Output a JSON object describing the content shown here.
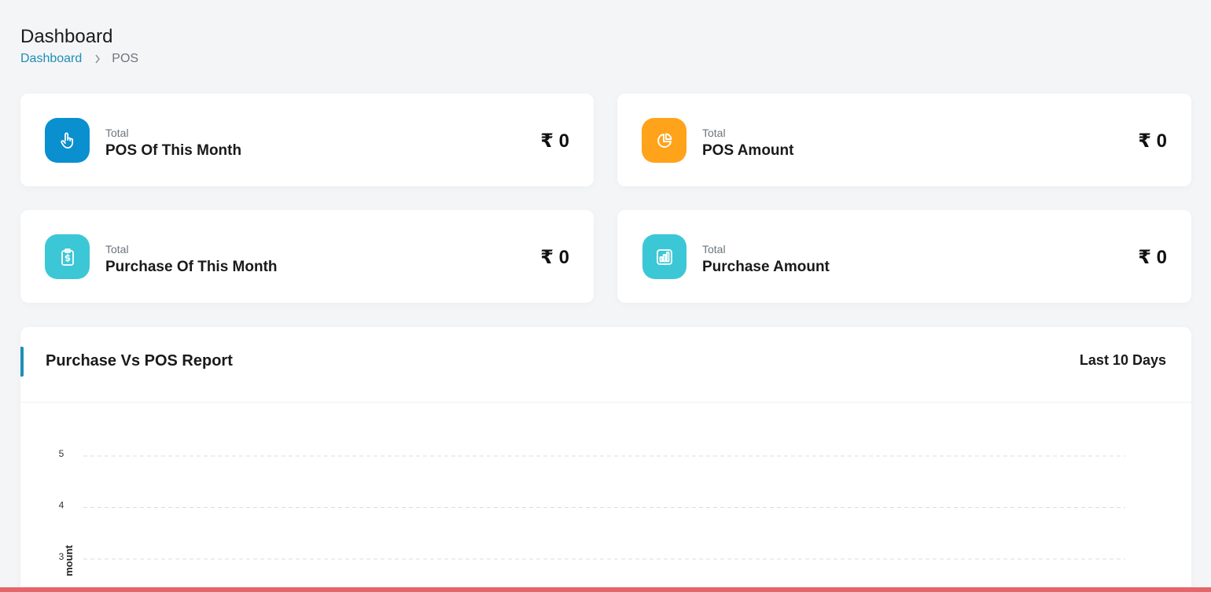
{
  "page": {
    "title": "Dashboard",
    "breadcrumb": {
      "home": "Dashboard",
      "current": "POS"
    }
  },
  "stats": [
    {
      "small": "Total",
      "label": "POS Of This Month",
      "value": "₹ 0",
      "icon": "pointer-hand-icon",
      "color": "#0a8fcf"
    },
    {
      "small": "Total",
      "label": "POS Amount",
      "value": "₹ 0",
      "icon": "pie-chart-icon",
      "color": "#ffa31a"
    },
    {
      "small": "Total",
      "label": "Purchase Of This Month",
      "value": "₹ 0",
      "icon": "clipboard-dollar-icon",
      "color": "#3cc7d6"
    },
    {
      "small": "Total",
      "label": "Purchase Amount",
      "value": "₹ 0",
      "icon": "bar-chart-icon",
      "color": "#3cc7d6"
    }
  ],
  "report": {
    "title": "Purchase Vs POS Report",
    "filter": "Last 10 Days"
  },
  "chart_data": {
    "type": "line",
    "ylabel": "mount",
    "y_ticks": [
      "5",
      "4",
      "3"
    ],
    "ylim": [
      0,
      5
    ],
    "grid": true,
    "series": []
  },
  "colors": {
    "accent": "#1f8fb5",
    "bottom_strip": "#e4666a"
  }
}
